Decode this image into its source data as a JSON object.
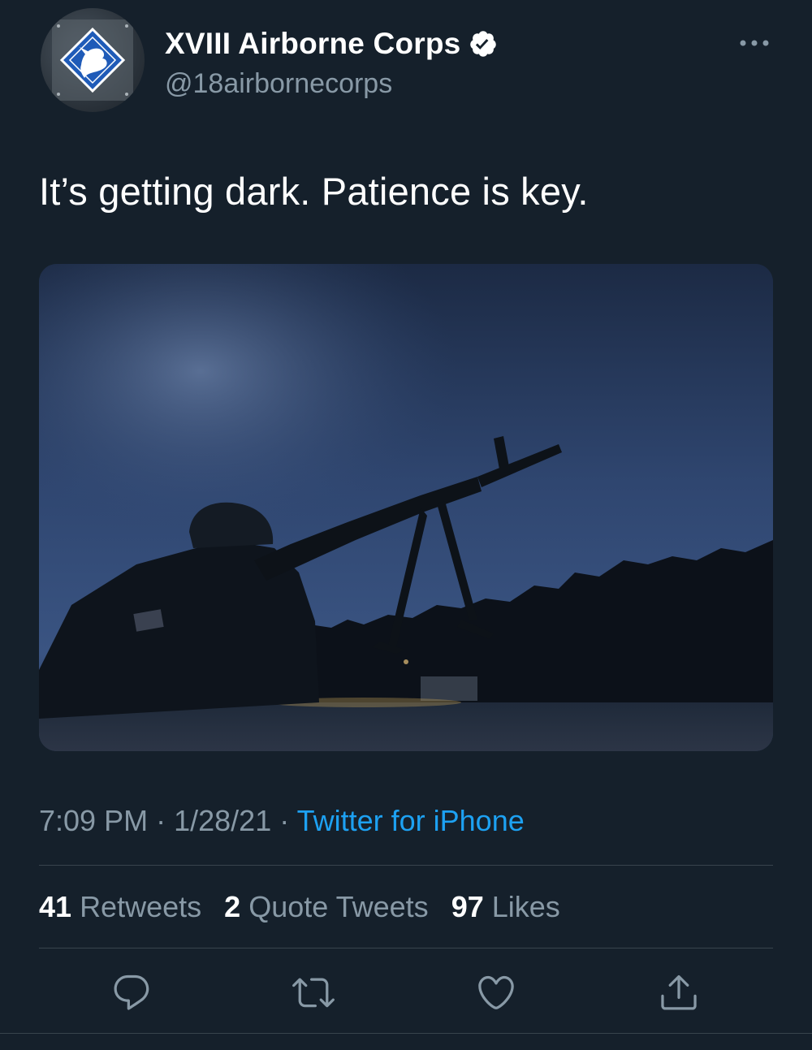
{
  "tweet": {
    "author": {
      "display_name": "XVIII Airborne Corps",
      "handle": "@18airbornecorps",
      "verified": true
    },
    "text": "It’s getting dark. Patience is key.",
    "time": "7:09 PM",
    "separator": "·",
    "date": "1/28/21",
    "source": "Twitter for iPhone",
    "stats": {
      "retweets": {
        "count": "41",
        "label": "Retweets"
      },
      "quote_tweets": {
        "count": "2",
        "label": "Quote Tweets"
      },
      "likes": {
        "count": "97",
        "label": "Likes"
      }
    }
  },
  "icons": {
    "more": "more-horizontal-icon",
    "verified": "verified-badge-icon",
    "reply": "reply-icon",
    "retweet": "retweet-icon",
    "like": "heart-icon",
    "share": "share-icon"
  },
  "colors": {
    "background": "#15202b",
    "accent": "#1da1f2",
    "secondary_text": "#8899a6",
    "divider": "#38444d"
  }
}
